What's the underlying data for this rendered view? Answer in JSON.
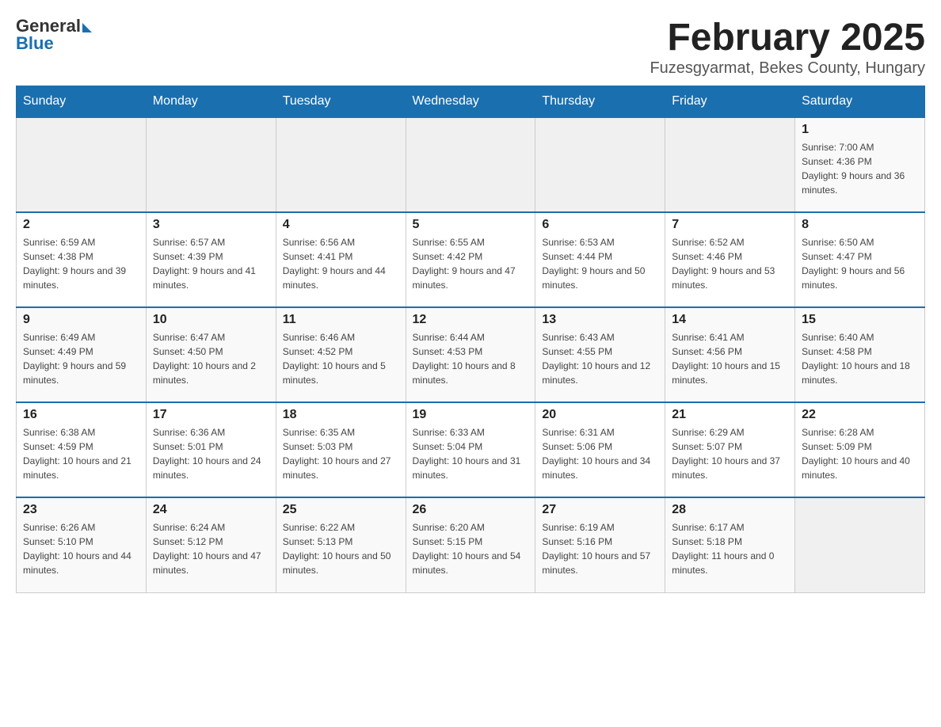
{
  "header": {
    "logo_general": "General",
    "logo_blue": "Blue",
    "month_title": "February 2025",
    "location": "Fuzesgyarmat, Bekes County, Hungary"
  },
  "days_of_week": [
    "Sunday",
    "Monday",
    "Tuesday",
    "Wednesday",
    "Thursday",
    "Friday",
    "Saturday"
  ],
  "weeks": [
    [
      {
        "day": "",
        "info": ""
      },
      {
        "day": "",
        "info": ""
      },
      {
        "day": "",
        "info": ""
      },
      {
        "day": "",
        "info": ""
      },
      {
        "day": "",
        "info": ""
      },
      {
        "day": "",
        "info": ""
      },
      {
        "day": "1",
        "info": "Sunrise: 7:00 AM\nSunset: 4:36 PM\nDaylight: 9 hours and 36 minutes."
      }
    ],
    [
      {
        "day": "2",
        "info": "Sunrise: 6:59 AM\nSunset: 4:38 PM\nDaylight: 9 hours and 39 minutes."
      },
      {
        "day": "3",
        "info": "Sunrise: 6:57 AM\nSunset: 4:39 PM\nDaylight: 9 hours and 41 minutes."
      },
      {
        "day": "4",
        "info": "Sunrise: 6:56 AM\nSunset: 4:41 PM\nDaylight: 9 hours and 44 minutes."
      },
      {
        "day": "5",
        "info": "Sunrise: 6:55 AM\nSunset: 4:42 PM\nDaylight: 9 hours and 47 minutes."
      },
      {
        "day": "6",
        "info": "Sunrise: 6:53 AM\nSunset: 4:44 PM\nDaylight: 9 hours and 50 minutes."
      },
      {
        "day": "7",
        "info": "Sunrise: 6:52 AM\nSunset: 4:46 PM\nDaylight: 9 hours and 53 minutes."
      },
      {
        "day": "8",
        "info": "Sunrise: 6:50 AM\nSunset: 4:47 PM\nDaylight: 9 hours and 56 minutes."
      }
    ],
    [
      {
        "day": "9",
        "info": "Sunrise: 6:49 AM\nSunset: 4:49 PM\nDaylight: 9 hours and 59 minutes."
      },
      {
        "day": "10",
        "info": "Sunrise: 6:47 AM\nSunset: 4:50 PM\nDaylight: 10 hours and 2 minutes."
      },
      {
        "day": "11",
        "info": "Sunrise: 6:46 AM\nSunset: 4:52 PM\nDaylight: 10 hours and 5 minutes."
      },
      {
        "day": "12",
        "info": "Sunrise: 6:44 AM\nSunset: 4:53 PM\nDaylight: 10 hours and 8 minutes."
      },
      {
        "day": "13",
        "info": "Sunrise: 6:43 AM\nSunset: 4:55 PM\nDaylight: 10 hours and 12 minutes."
      },
      {
        "day": "14",
        "info": "Sunrise: 6:41 AM\nSunset: 4:56 PM\nDaylight: 10 hours and 15 minutes."
      },
      {
        "day": "15",
        "info": "Sunrise: 6:40 AM\nSunset: 4:58 PM\nDaylight: 10 hours and 18 minutes."
      }
    ],
    [
      {
        "day": "16",
        "info": "Sunrise: 6:38 AM\nSunset: 4:59 PM\nDaylight: 10 hours and 21 minutes."
      },
      {
        "day": "17",
        "info": "Sunrise: 6:36 AM\nSunset: 5:01 PM\nDaylight: 10 hours and 24 minutes."
      },
      {
        "day": "18",
        "info": "Sunrise: 6:35 AM\nSunset: 5:03 PM\nDaylight: 10 hours and 27 minutes."
      },
      {
        "day": "19",
        "info": "Sunrise: 6:33 AM\nSunset: 5:04 PM\nDaylight: 10 hours and 31 minutes."
      },
      {
        "day": "20",
        "info": "Sunrise: 6:31 AM\nSunset: 5:06 PM\nDaylight: 10 hours and 34 minutes."
      },
      {
        "day": "21",
        "info": "Sunrise: 6:29 AM\nSunset: 5:07 PM\nDaylight: 10 hours and 37 minutes."
      },
      {
        "day": "22",
        "info": "Sunrise: 6:28 AM\nSunset: 5:09 PM\nDaylight: 10 hours and 40 minutes."
      }
    ],
    [
      {
        "day": "23",
        "info": "Sunrise: 6:26 AM\nSunset: 5:10 PM\nDaylight: 10 hours and 44 minutes."
      },
      {
        "day": "24",
        "info": "Sunrise: 6:24 AM\nSunset: 5:12 PM\nDaylight: 10 hours and 47 minutes."
      },
      {
        "day": "25",
        "info": "Sunrise: 6:22 AM\nSunset: 5:13 PM\nDaylight: 10 hours and 50 minutes."
      },
      {
        "day": "26",
        "info": "Sunrise: 6:20 AM\nSunset: 5:15 PM\nDaylight: 10 hours and 54 minutes."
      },
      {
        "day": "27",
        "info": "Sunrise: 6:19 AM\nSunset: 5:16 PM\nDaylight: 10 hours and 57 minutes."
      },
      {
        "day": "28",
        "info": "Sunrise: 6:17 AM\nSunset: 5:18 PM\nDaylight: 11 hours and 0 minutes."
      },
      {
        "day": "",
        "info": ""
      }
    ]
  ]
}
